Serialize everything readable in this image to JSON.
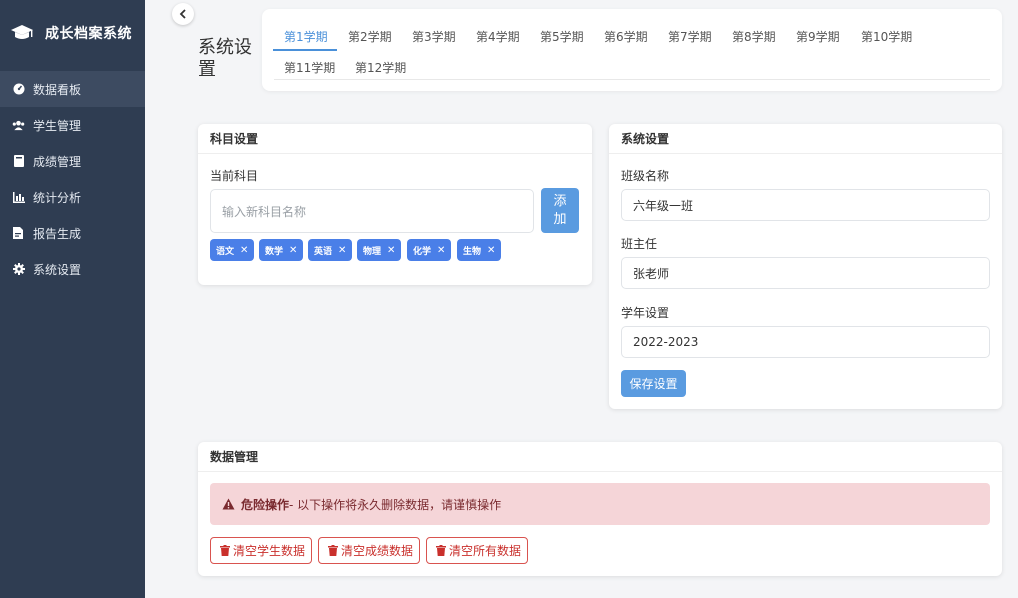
{
  "app": {
    "title": "成长档案系统"
  },
  "sidebar": {
    "items": [
      {
        "label": "数据看板",
        "icon": "dashboard-icon"
      },
      {
        "label": "学生管理",
        "icon": "users-icon"
      },
      {
        "label": "成绩管理",
        "icon": "book-icon"
      },
      {
        "label": "统计分析",
        "icon": "bar-chart-icon"
      },
      {
        "label": "报告生成",
        "icon": "report-icon"
      },
      {
        "label": "系统设置",
        "icon": "gear-icon"
      }
    ]
  },
  "page": {
    "title": "系统设置"
  },
  "tabs": [
    "第1学期",
    "第2学期",
    "第3学期",
    "第4学期",
    "第5学期",
    "第6学期",
    "第7学期",
    "第8学期",
    "第9学期",
    "第10学期",
    "第11学期",
    "第12学期"
  ],
  "subject_card": {
    "title": "科目设置",
    "current_label": "当前科目",
    "input_placeholder": "输入新科目名称",
    "add_label": "添加",
    "tags": [
      "语文",
      "数学",
      "英语",
      "物理",
      "化学",
      "生物"
    ]
  },
  "system_card": {
    "title": "系统设置",
    "class_label": "班级名称",
    "class_value": "六年级一班",
    "teacher_label": "班主任",
    "teacher_value": "张老师",
    "year_label": "学年设置",
    "year_value": "2022-2023",
    "save_label": "保存设置"
  },
  "data_card": {
    "title": "数据管理",
    "alert_strong": "危险操作",
    "alert_text": " - 以下操作将永久删除数据，请谨慎操作",
    "buttons": [
      "清空学生数据",
      "清空成绩数据",
      "清空所有数据"
    ]
  },
  "colors": {
    "sidebar": "#2f3d52",
    "accent": "#4a90d9",
    "tag": "#4a7fe8",
    "danger": "#d9534f"
  }
}
